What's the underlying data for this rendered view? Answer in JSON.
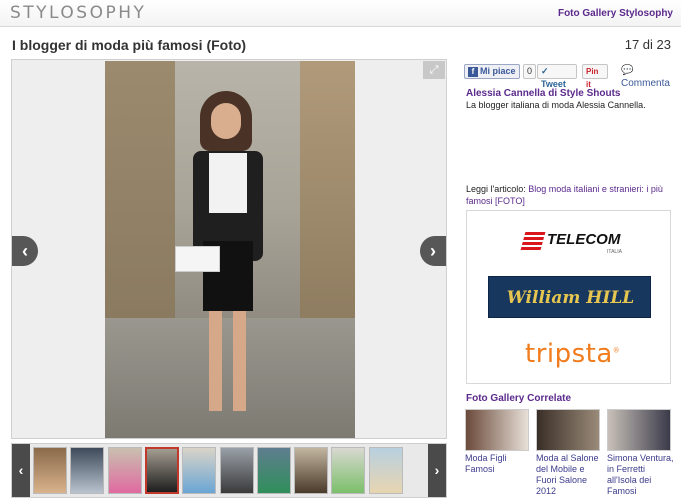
{
  "header": {
    "logo": "STYLOSOPHY",
    "gallery_link": "Foto Gallery Stylosophy"
  },
  "gallery": {
    "title": "I blogger di moda più famosi (Foto)",
    "counter": "17 di 23",
    "prev_arrow": "‹",
    "next_arrow": "›",
    "expand_icon": "⤢",
    "thumbnails": [
      {
        "colors": [
          "#8a6a4a",
          "#d9b38c"
        ]
      },
      {
        "colors": [
          "#3e4a5a",
          "#b9c3cf"
        ]
      },
      {
        "colors": [
          "#c9c0b0",
          "#e06aa0"
        ]
      },
      {
        "colors": [
          "#a39c90",
          "#1e1e1e"
        ],
        "active": true
      },
      {
        "colors": [
          "#d9d4c8",
          "#6aa5d4"
        ]
      },
      {
        "colors": [
          "#9aa0a8",
          "#3a3a3a"
        ]
      },
      {
        "colors": [
          "#5f7d8f",
          "#2f8f5a"
        ]
      },
      {
        "colors": [
          "#c2b5a0",
          "#4a3a2a"
        ]
      },
      {
        "colors": [
          "#d8d8d0",
          "#7bbf6a"
        ]
      },
      {
        "colors": [
          "#b8d0e0",
          "#e8d5b0"
        ]
      }
    ]
  },
  "social": {
    "fb_like": "Mi piace",
    "fb_count": "0",
    "tweet": "Tweet",
    "pinit": "Pin it",
    "comment": "Commenta"
  },
  "sidebar": {
    "title": "Alessia Cannella di Style Shouts",
    "description": "La blogger italiana di moda Alessia Cannella.",
    "read_prefix": "Leggi l'articolo:",
    "read_link": "Blog moda italiani e stranieri: i più famosi [FOTO]"
  },
  "ads": {
    "telecom": "TELECOM",
    "telecom_sub": "ITALIA",
    "william_hill": "William HILL",
    "tripsta": "tripsta",
    "tripsta_mark": "®"
  },
  "related": {
    "title": "Foto Gallery Correlate",
    "items": [
      {
        "caption": "Moda Figli Famosi",
        "colors": [
          "#6b4a3a",
          "#e8e0d8"
        ]
      },
      {
        "caption": "Moda al Salone del Mobile e Fuori Salone 2012",
        "colors": [
          "#3a2f28",
          "#9a8a78"
        ]
      },
      {
        "caption": "Simona Ventura, in Ferretti all'Isola dei Famosi",
        "colors": [
          "#c8c0b8",
          "#3a3a4a"
        ]
      }
    ]
  },
  "colors": {
    "brand_purple": "#5b2a8c",
    "active_thumb": "#c0392b",
    "tripsta_orange": "#f07c1e",
    "william_blue": "#17375e"
  }
}
